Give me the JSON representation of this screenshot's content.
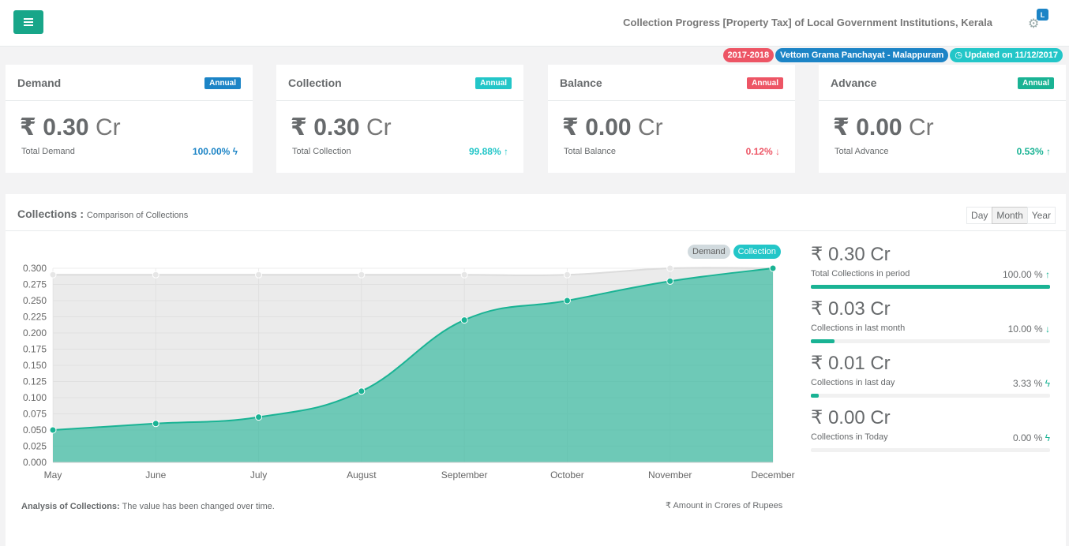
{
  "header": {
    "title": "Collection Progress [Property Tax] of Local Government Institutions, Kerala",
    "avatar_letter": "L",
    "menu_icon": "hamburger-icon",
    "settings_icon": "gear-icon"
  },
  "tags": {
    "year": "2017-2018",
    "institution": "Vettom Grama Panchayat - Malappuram",
    "updated": "Updated on 11/12/2017"
  },
  "cards": [
    {
      "title": "Demand",
      "badge": "Annual",
      "value": "0.30",
      "unit": "Cr",
      "currency": "₹",
      "label": "Total Demand",
      "percent": "100.00%",
      "trend": "bolt-icon",
      "color": "#1c84c6"
    },
    {
      "title": "Collection",
      "badge": "Annual",
      "value": "0.30",
      "unit": "Cr",
      "currency": "₹",
      "label": "Total Collection",
      "percent": "99.88%",
      "trend": "arrow-up-icon",
      "color": "#23c6c8"
    },
    {
      "title": "Balance",
      "badge": "Annual",
      "value": "0.00",
      "unit": "Cr",
      "currency": "₹",
      "label": "Total Balance",
      "percent": "0.12%",
      "trend": "arrow-down-icon",
      "color": "#ed5565"
    },
    {
      "title": "Advance",
      "badge": "Annual",
      "value": "0.00",
      "unit": "Cr",
      "currency": "₹",
      "label": "Total Advance",
      "percent": "0.53%",
      "trend": "arrow-up-icon",
      "color": "#1ab394"
    }
  ],
  "panel": {
    "title": "Collections :",
    "subtitle": "Comparison of Collections",
    "periods": [
      "Day",
      "Month",
      "Year"
    ],
    "active_period": "Month",
    "analysis_label": "Analysis of Collections:",
    "analysis_text": "The value has been changed over time.",
    "unit_note": "₹ Amount in Crores of Rupees"
  },
  "chart_data": {
    "type": "area",
    "categories": [
      "May",
      "June",
      "July",
      "August",
      "September",
      "October",
      "November",
      "December"
    ],
    "series": [
      {
        "name": "Demand",
        "values": [
          0.29,
          0.29,
          0.29,
          0.29,
          0.29,
          0.29,
          0.3,
          0.3
        ],
        "color": "#d0d0d0"
      },
      {
        "name": "Collection",
        "values": [
          0.05,
          0.06,
          0.07,
          0.11,
          0.22,
          0.25,
          0.28,
          0.3
        ],
        "color": "#1ab394"
      }
    ],
    "yticks": [
      "0.300",
      "0.275",
      "0.250",
      "0.225",
      "0.200",
      "0.175",
      "0.150",
      "0.125",
      "0.100",
      "0.075",
      "0.050",
      "0.025",
      "0.000"
    ],
    "ylim": [
      0,
      0.3
    ],
    "grid": true
  },
  "stats": [
    {
      "value": "0.30",
      "unit": "Cr",
      "currency": "₹",
      "label": "Total Collections in period",
      "percent": "100.00 %",
      "trend": "arrow-up-icon",
      "progress": 1.0
    },
    {
      "value": "0.03",
      "unit": "Cr",
      "currency": "₹",
      "label": "Collections in last month",
      "percent": "10.00 %",
      "trend": "arrow-down-icon",
      "progress": 0.1
    },
    {
      "value": "0.01",
      "unit": "Cr",
      "currency": "₹",
      "label": "Collections in last day",
      "percent": "3.33 %",
      "trend": "bolt-icon",
      "progress": 0.0333
    },
    {
      "value": "0.00",
      "unit": "Cr",
      "currency": "₹",
      "label": "Collections in Today",
      "percent": "0.00 %",
      "trend": "bolt-icon",
      "progress": 0.0
    }
  ]
}
